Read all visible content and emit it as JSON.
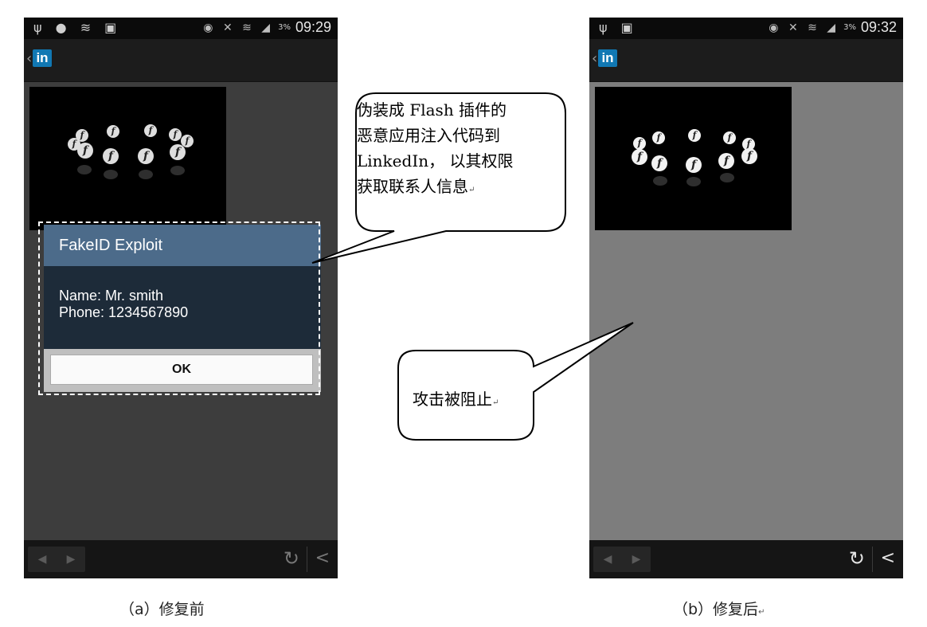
{
  "colors": {
    "linkedin_blue": "#1178b3",
    "dialog_header": "#4c6b8a",
    "dialog_body": "#1d2b39",
    "screen_before": "#3d3d3d",
    "screen_after": "#7d7d7d"
  },
  "panel_a": {
    "status": {
      "left_icons": [
        "usb-icon",
        "browser-icon",
        "wifi-icon",
        "sim-icon"
      ],
      "right_icons": [
        "eye-icon",
        "mute-icon",
        "wifi-icon",
        "signal-icon"
      ],
      "battery": "3%",
      "time": "09:29"
    },
    "app_logo": "in",
    "dialog": {
      "title": "FakeID Exploit",
      "name_line": "Name: Mr. smith",
      "phone_line": "Phone: 1234567890",
      "ok_label": "OK"
    },
    "callout": {
      "lines": [
        "伪装成 Flash 插件的",
        "恶意应用注入代码到",
        "LinkedIn， 以其权限",
        "获取联系人信息"
      ],
      "return_mark": "↵"
    },
    "caption": "（a）修复前"
  },
  "panel_b": {
    "status": {
      "left_icons": [
        "usb-icon",
        "sim-icon"
      ],
      "right_icons": [
        "eye-icon",
        "mute-icon",
        "wifi-icon",
        "signal-icon"
      ],
      "battery": "3%",
      "time": "09:32"
    },
    "app_logo": "in",
    "callout": {
      "text": "攻击被阻止",
      "return_mark": "↵"
    },
    "caption": "（b）修复后",
    "caption_return": "↵"
  }
}
